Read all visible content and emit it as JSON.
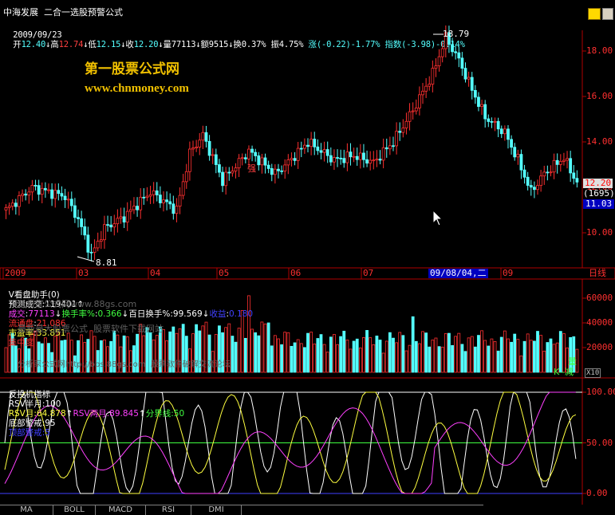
{
  "header": {
    "title": "中海发展  二合一选股预警公式",
    "date": "2009/09/23",
    "open_label": "开",
    "open": "12.40",
    "high_label": "高",
    "high": "12.74",
    "low_label": "低",
    "low": "12.15",
    "close_label": "收",
    "close": "12.20",
    "volume_label": "量",
    "volume": "77113",
    "amount_label": "额",
    "amount": "9515",
    "turnover_label": "换",
    "turnover": "0.37%",
    "amplitude_label": "振",
    "amplitude": "4.75%",
    "change_label": "涨",
    "change": "(-0.22)-1.77%",
    "index_label": "指数",
    "index_change": "(-3.98)-0.14%",
    "arrow_up": "↑",
    "arrow_down": "↓"
  },
  "watermark": {
    "brand": "第一股票公式网",
    "url": "www.chnmoney.com",
    "faint1": "分析家公式网www.88gs.com",
    "faint2": "最新最大股票公式  股票软件下载网站",
    "faint3": "分析家公式网http://bbs.88gs.com  股票软件破解交流论坛"
  },
  "price_chart": {
    "axis_labels": [
      "18.00",
      "16.00",
      "14.00",
      "12.00",
      "10.00"
    ],
    "high_marker": "18.79",
    "low_marker": "8.81",
    "current_price": "12.20",
    "cursor_code": "(1695)",
    "cursor_price": "11.03",
    "annotation": "强",
    "time_labels": [
      "2009",
      "03",
      "04",
      "05",
      "06",
      "07",
      "09",
      "09"
    ],
    "time_label_08": "08",
    "date_cursor": "09/08/04,二",
    "right_tab": "日线",
    "colors": {
      "up": "#ff3030",
      "down": "#54ffff"
    }
  },
  "volume_panel": {
    "indicator_name": "V看盘助手(0)",
    "predict_label": "预测成交",
    "predict_value": "119401",
    "volume_label": "成交",
    "volume_value": "77113",
    "turnover_label": "换手率%",
    "turnover_value": "0.366",
    "hundred_label": "百日换手%",
    "hundred_value": "99.569",
    "profit_label": "收益",
    "profit_value": "0.180",
    "float_label": "流通盘",
    "float_value": "21.086",
    "pe_label": "市盈率",
    "pe_value": "33.851",
    "concentration_label": "集中度",
    "axis_labels": [
      "60000",
      "40000",
      "20000"
    ],
    "side_label_1": "量",
    "side_label_2": "K--减",
    "multiplier": "X10"
  },
  "oscillator": {
    "name": "反投机指标",
    "rsv_half_label": "RSV半月",
    "rsv_half_value": "100",
    "rsv_label": "RSV月",
    "rsv_value": "64.878",
    "rsv_two_label": "RSV两月",
    "rsv_two_value": "89.845",
    "divide_label": "分界线",
    "divide_value": "50",
    "bottom_label": "底部警戒",
    "bottom_value": "95",
    "top_label": "顶部警戒",
    "top_value": "5",
    "axis_labels": [
      "100.00",
      "50.00",
      "0.00"
    ]
  },
  "tabs": [
    "MA",
    "BOLL",
    "MACD",
    "RSI",
    "DMI"
  ]
}
